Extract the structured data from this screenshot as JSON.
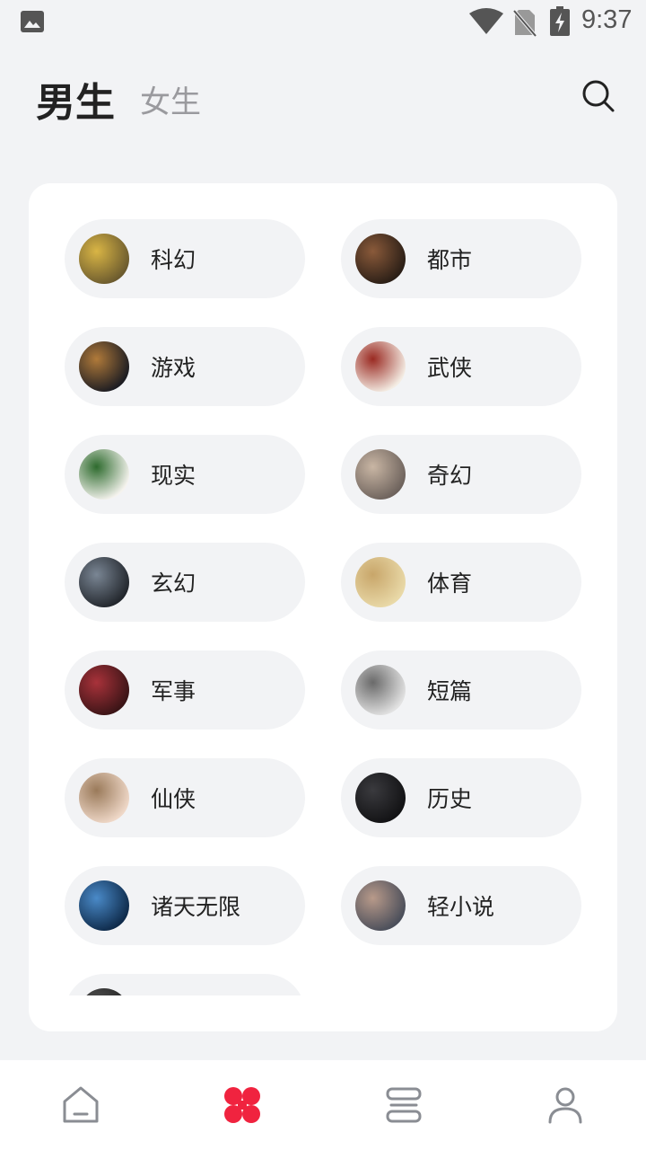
{
  "status_bar": {
    "time": "9:37",
    "icons": [
      "image-icon",
      "wifi-icon",
      "no-sim-icon",
      "battery-charging-icon"
    ]
  },
  "header": {
    "tabs": [
      {
        "label": "男生",
        "active": true
      },
      {
        "label": "女生",
        "active": false
      }
    ],
    "search_icon": "search-icon"
  },
  "categories": [
    {
      "label": "科幻",
      "cover_colors": [
        "#6b5a2e",
        "#d9b545"
      ]
    },
    {
      "label": "都市",
      "cover_colors": [
        "#2a1e16",
        "#8a5a3a"
      ]
    },
    {
      "label": "游戏",
      "cover_colors": [
        "#1c1c22",
        "#b07a3a"
      ]
    },
    {
      "label": "武侠",
      "cover_colors": [
        "#f4ede4",
        "#9a2a22"
      ]
    },
    {
      "label": "现实",
      "cover_colors": [
        "#f5f3ee",
        "#2e6b2e"
      ]
    },
    {
      "label": "奇幻",
      "cover_colors": [
        "#6d625c",
        "#c9b6a4"
      ]
    },
    {
      "label": "玄幻",
      "cover_colors": [
        "#22262c",
        "#7a8694"
      ]
    },
    {
      "label": "体育",
      "cover_colors": [
        "#e9d9a8",
        "#c8a66a"
      ]
    },
    {
      "label": "军事",
      "cover_colors": [
        "#3a1416",
        "#a8323a"
      ]
    },
    {
      "label": "短篇",
      "cover_colors": [
        "#e2e2e2",
        "#6a6a6a"
      ]
    },
    {
      "label": "仙侠",
      "cover_colors": [
        "#efd8c8",
        "#9a7a5a"
      ]
    },
    {
      "label": "历史",
      "cover_colors": [
        "#121214",
        "#3a3a3e"
      ]
    },
    {
      "label": "诸天无限",
      "cover_colors": [
        "#0e2a4a",
        "#4a8ac8"
      ]
    },
    {
      "label": "轻小说",
      "cover_colors": [
        "#4a4e5a",
        "#b89a8a"
      ]
    },
    {
      "label": "",
      "cover_colors": [
        "#222222",
        "#555555"
      ]
    }
  ],
  "bottom_nav": [
    {
      "name": "home",
      "icon": "home-icon",
      "active": false
    },
    {
      "name": "category",
      "icon": "category-icon",
      "active": true
    },
    {
      "name": "bookshelf",
      "icon": "bookshelf-icon",
      "active": false
    },
    {
      "name": "profile",
      "icon": "profile-icon",
      "active": false
    }
  ],
  "colors": {
    "accent": "#f0233f",
    "background": "#f2f3f5",
    "pill": "#f2f3f5",
    "inactive_tab": "#9a9a9e"
  }
}
